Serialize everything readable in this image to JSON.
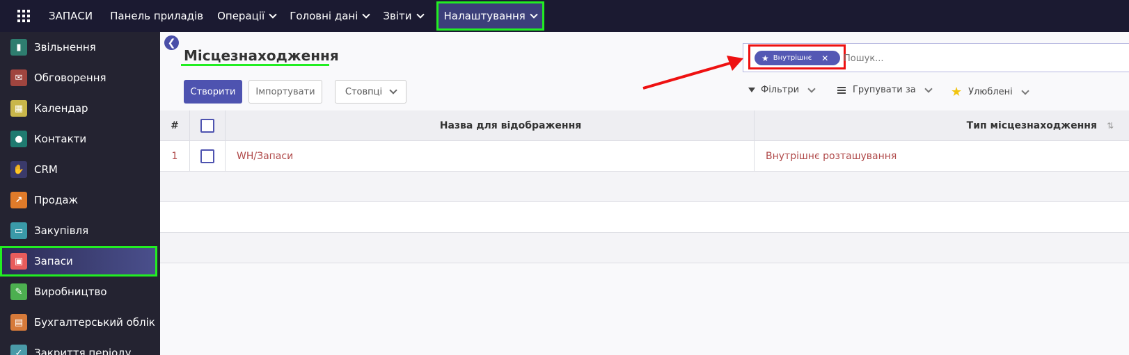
{
  "topbar": {
    "brand": "ЗАПАСИ",
    "menu": [
      {
        "label": "Панель приладів",
        "dropdown": false
      },
      {
        "label": "Операції",
        "dropdown": true
      },
      {
        "label": "Головні дані",
        "dropdown": true
      },
      {
        "label": "Звіти",
        "dropdown": true
      },
      {
        "label": "Налаштування",
        "dropdown": true
      }
    ]
  },
  "sidebar": {
    "items": [
      {
        "label": "Звільнення",
        "icon": "dismissal-icon",
        "color": "#2e7d6f"
      },
      {
        "label": "Обговорення",
        "icon": "discuss-icon",
        "color": "#a0453f"
      },
      {
        "label": "Календар",
        "icon": "calendar-icon",
        "color": "#c9b64a"
      },
      {
        "label": "Контакти",
        "icon": "contacts-icon",
        "color": "#1f7a70"
      },
      {
        "label": "CRM",
        "icon": "handshake-icon",
        "color": "#3a3a6a"
      },
      {
        "label": "Продаж",
        "icon": "sales-chart-icon",
        "color": "#e07b2a"
      },
      {
        "label": "Закупівля",
        "icon": "purchase-icon",
        "color": "#3a9aa8"
      },
      {
        "label": "Запаси",
        "icon": "inventory-icon",
        "color": "#e85c5c"
      },
      {
        "label": "Виробництво",
        "icon": "wrench-icon",
        "color": "#4caf50"
      },
      {
        "label": "Бухгалтерський облік",
        "icon": "accounting-icon",
        "color": "#d67a3a"
      },
      {
        "label": "Закриття періоду",
        "icon": "period-close-icon",
        "color": "#4a9aa8"
      }
    ]
  },
  "page": {
    "title": "Місцезнаходження",
    "create_label": "Створити",
    "import_label": "Імпортувати",
    "columns_label": "Стовпці"
  },
  "search": {
    "facet_label": "Внутрішнє",
    "placeholder": "Пошук..."
  },
  "toolbar": {
    "filters_label": "Фільтри",
    "group_label": "Групувати за",
    "favorites_label": "Улюблені"
  },
  "table": {
    "headers": {
      "num": "#",
      "name": "Назва для відображення",
      "type": "Тип місцезнаходження"
    },
    "rows": [
      {
        "num": "1",
        "name": "WH/Запаси",
        "type": "Внутрішнє розташування"
      }
    ]
  },
  "colors": {
    "navbar": "#1b1a31",
    "sidebar": "#242331",
    "primary": "#4e53b0",
    "link": "#b04a4a",
    "highlight_green": "#22ee22",
    "highlight_red": "#ee1111"
  }
}
